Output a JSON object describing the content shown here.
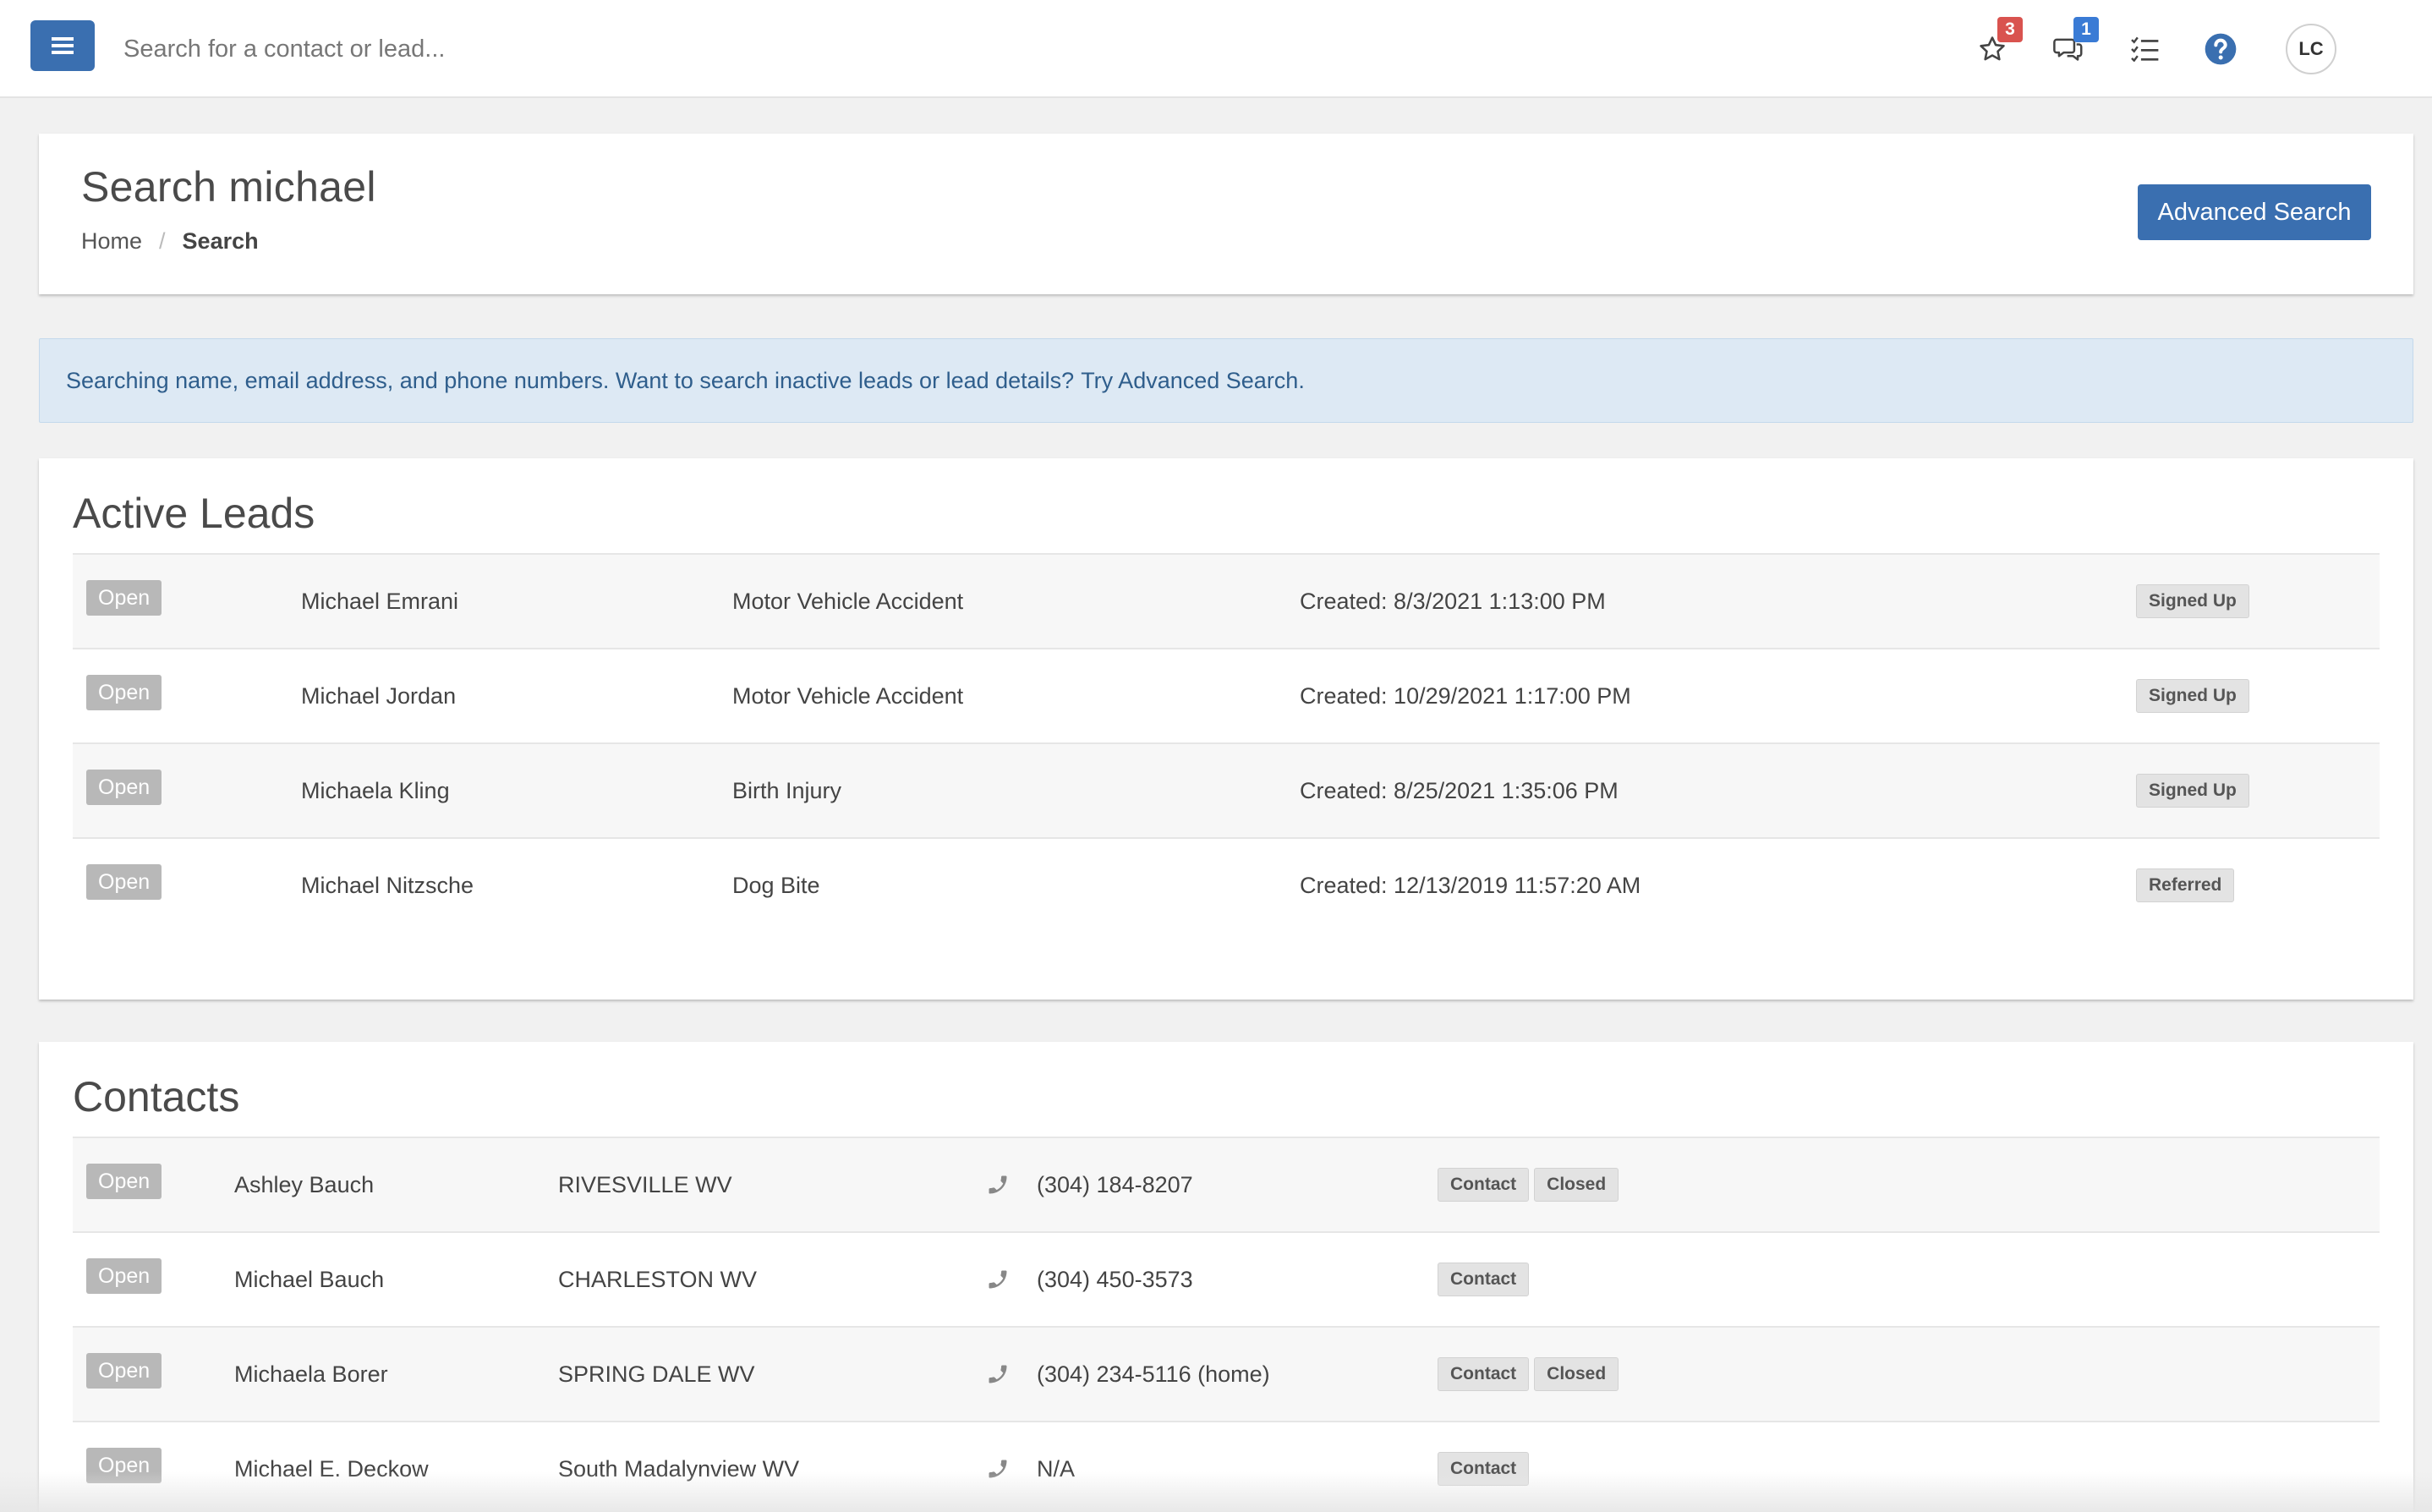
{
  "topbar": {
    "search_placeholder": "Search for a contact or lead...",
    "favorites_badge": "3",
    "messages_badge": "1",
    "avatar_initials": "LC",
    "colors": {
      "primary": "#3a6fb0",
      "badge_red": "#d9534f",
      "badge_blue": "#3a7bd5"
    }
  },
  "header": {
    "title": "Search michael",
    "breadcrumb": {
      "home": "Home",
      "separator": "/",
      "current": "Search"
    },
    "advanced_search_label": "Advanced Search"
  },
  "alert": {
    "text": "Searching name, email address, and phone numbers. Want to search inactive leads or lead details?",
    "link_text": "Try Advanced Search."
  },
  "active_leads": {
    "title": "Active Leads",
    "rows": [
      {
        "action": "Open",
        "name": "Michael Emrani",
        "case_type": "Motor Vehicle Accident",
        "created": "Created: 8/3/2021 1:13:00 PM",
        "status": "Signed Up"
      },
      {
        "action": "Open",
        "name": "Michael Jordan",
        "case_type": "Motor Vehicle Accident",
        "created": "Created: 10/29/2021 1:17:00 PM",
        "status": "Signed Up"
      },
      {
        "action": "Open",
        "name": "Michaela Kling",
        "case_type": "Birth Injury",
        "created": "Created: 8/25/2021 1:35:06 PM",
        "status": "Signed Up"
      },
      {
        "action": "Open",
        "name": "Michael Nitzsche",
        "case_type": "Dog Bite",
        "created": "Created: 12/13/2019 11:57:20 AM",
        "status": "Referred"
      }
    ]
  },
  "contacts": {
    "title": "Contacts",
    "rows": [
      {
        "action": "Open",
        "name": "Ashley Bauch",
        "location": "RIVESVILLE WV",
        "phone": "(304) 184-8207",
        "tags": [
          "Contact",
          "Closed"
        ]
      },
      {
        "action": "Open",
        "name": "Michael Bauch",
        "location": "CHARLESTON WV",
        "phone": "(304) 450-3573",
        "tags": [
          "Contact"
        ]
      },
      {
        "action": "Open",
        "name": "Michaela Borer",
        "location": "SPRING DALE WV",
        "phone": "(304) 234-5116 (home)",
        "tags": [
          "Contact",
          "Closed"
        ]
      },
      {
        "action": "Open",
        "name": "Michael E. Deckow",
        "location": "South Madalynview WV",
        "phone": "N/A",
        "tags": [
          "Contact"
        ]
      }
    ]
  }
}
